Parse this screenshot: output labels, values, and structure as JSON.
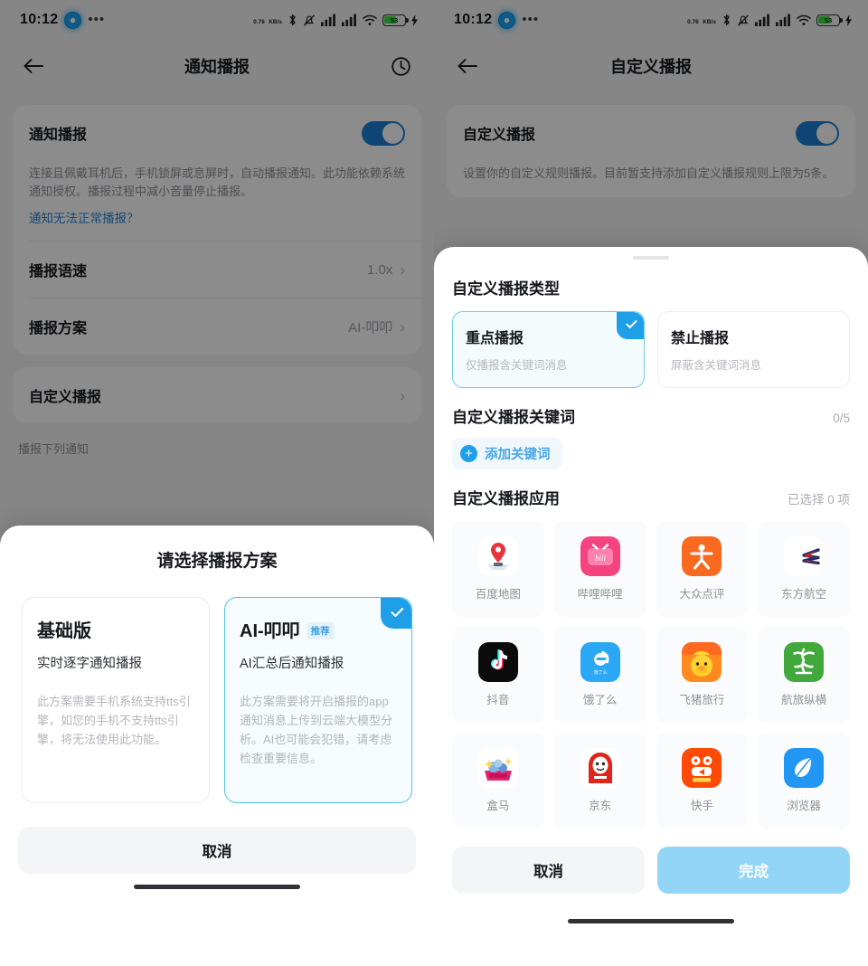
{
  "left": {
    "statusbar": {
      "time": "10:12",
      "net_speed_top": "0.76",
      "net_speed_bottom": "KB/s",
      "battery_level": "53"
    },
    "nav": {
      "title": "通知播报",
      "back_icon": "arrow-left-icon",
      "right_icon": "history-clock-icon"
    },
    "rows": [
      {
        "label": "通知播报",
        "type": "switch",
        "on": true
      },
      {
        "label": "播报语速",
        "value": "1.0x"
      },
      {
        "label": "播报方案",
        "value": "AI-叩叩"
      },
      {
        "label": "自定义播报",
        "value": ""
      }
    ],
    "description": "连接且佩戴耳机后，手机锁屏或息屏时，自动播报通知。此功能依赖系统通知授权。播报过程中减小音量停止播报。",
    "help_link": "通知无法正常播报？",
    "group_title": "播报下列通知",
    "sheet": {
      "title": "请选择播报方案",
      "plans": [
        {
          "name": "基础版",
          "tag": "",
          "subtitle": "实时逐字通知播报",
          "note": "此方案需要手机系统支持tts引擎，如您的手机不支持tts引擎，将无法使用此功能。",
          "selected": false
        },
        {
          "name": "AI-叩叩",
          "tag": "推荐",
          "subtitle": "AI汇总后通知播报",
          "note": "此方案需要将开启播报的app通知消息上传到云端大模型分析。AI也可能会犯错，请考虑检查重要信息。",
          "selected": true
        }
      ],
      "cancel_label": "取消"
    }
  },
  "right": {
    "statusbar": {
      "time": "10:12",
      "net_speed_top": "0.76",
      "net_speed_bottom": "KB/s",
      "battery_level": "53"
    },
    "nav": {
      "title": "自定义播报",
      "back_icon": "arrow-left-icon"
    },
    "rows": [
      {
        "label": "自定义播报",
        "type": "switch",
        "on": true
      }
    ],
    "description": "设置你的自定义规则播报。目前暂支持添加自定义播报规则上限为5条。",
    "sheet": {
      "type_section_title": "自定义播报类型",
      "types": [
        {
          "name": "重点播报",
          "sub": "仅播报含关键词消息",
          "selected": true
        },
        {
          "name": "禁止播报",
          "sub": "屏蔽含关键词消息",
          "selected": false
        }
      ],
      "keyword_section_title": "自定义播报关键词",
      "keyword_count": "0/5",
      "add_keyword_label": "添加关键词",
      "apps_section_title": "自定义播报应用",
      "apps_selected_label": "已选择 0 项",
      "apps": [
        {
          "name": "百度地图",
          "icon": "baidu-map-icon"
        },
        {
          "name": "哔哩哔哩",
          "icon": "bilibili-icon"
        },
        {
          "name": "大众点评",
          "icon": "dianping-icon"
        },
        {
          "name": "东方航空",
          "icon": "china-eastern-icon"
        },
        {
          "name": "抖音",
          "icon": "douyin-icon"
        },
        {
          "name": "饿了么",
          "icon": "eleme-icon"
        },
        {
          "name": "飞猪旅行",
          "icon": "fliggy-icon"
        },
        {
          "name": "航旅纵横",
          "icon": "umetrip-icon"
        },
        {
          "name": "盒马",
          "icon": "hema-icon"
        },
        {
          "name": "京东",
          "icon": "jd-icon"
        },
        {
          "name": "快手",
          "icon": "kuaishou-icon"
        },
        {
          "name": "浏览器",
          "icon": "browser-icon"
        },
        {
          "name": "",
          "icon": "partial-app-icon-1"
        },
        {
          "name": "",
          "icon": "partial-app-icon-2"
        }
      ],
      "cancel_label": "取消",
      "done_label": "完成"
    }
  },
  "colors": {
    "accent": "#1f9fe8",
    "switch_on": "#1b7fd4",
    "primary_disabled": "#93d5f7",
    "link": "#2b86d6"
  }
}
